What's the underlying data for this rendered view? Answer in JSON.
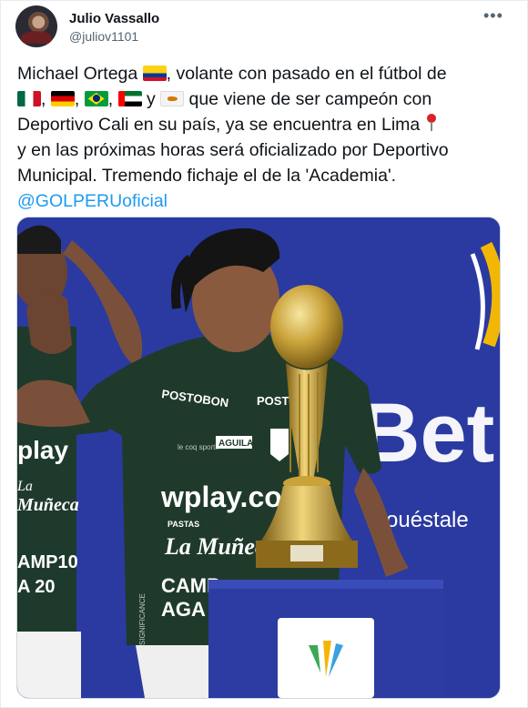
{
  "author": {
    "name": "Julio Vassallo",
    "handle": "@juliov1101"
  },
  "menu_icon": "more-horizontal-icon",
  "tweet": {
    "lines": [
      "Michael Ortega",
      ", volante con pasado en el fútbol de",
      ",",
      ",",
      ",",
      "y",
      "que viene de ser campeón con",
      "Deportivo Cali en su país, ya se encuentra en Lima",
      "y en las próximas horas será oficializado por Deportivo",
      "Municipal. Tremendo fichaje el de la 'Academia'."
    ],
    "mention": "@GOLPERUoficial",
    "flags": [
      "colombia-flag-icon",
      "mexico-flag-icon",
      "germany-flag-icon",
      "brazil-flag-icon",
      "uae-flag-icon",
      "cyprus-flag-icon"
    ],
    "pin_icon": "round-pushpin-icon"
  },
  "photo": {
    "left_jersey": "play",
    "left_text": [
      "La",
      "Muñeca"
    ],
    "left_bottom": [
      "AMP10",
      "A 20"
    ],
    "sponsor_top_left": "POSTOBON",
    "sponsor_top_right": "POSTOB",
    "badge": "AGUILA",
    "brand_main": "wplay.co",
    "brand_small": "PASTAS",
    "brand_muneca": "La Muñeca",
    "brand_camp": "CAMP",
    "brand_camp2": "AGA",
    "board_big": "Bet",
    "board_small": "ouéstale",
    "side_text": "SIGNIFICANCE",
    "kit": "le coq sportif"
  }
}
